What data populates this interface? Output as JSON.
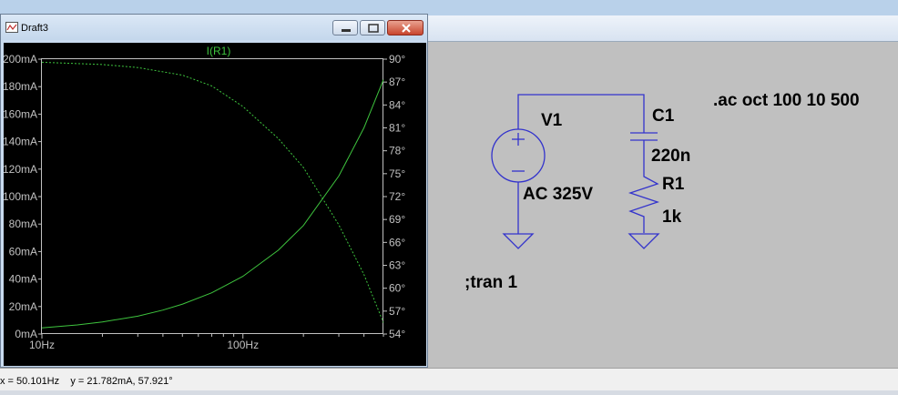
{
  "window": {
    "title": "Draft3",
    "trace_name": "I(R1)"
  },
  "chart_data": {
    "type": "line",
    "title": "I(R1)",
    "x_scale": "log",
    "xlim": [
      10,
      500
    ],
    "x_tick_labels": [
      "10Hz",
      "100Hz"
    ],
    "ylim_left": [
      0,
      200
    ],
    "y_left_ticks": [
      "200mA",
      "180mA",
      "160mA",
      "140mA",
      "120mA",
      "100mA",
      "80mA",
      "60mA",
      "40mA",
      "20mA",
      "0mA"
    ],
    "ylim_right": [
      54,
      90
    ],
    "y_right_ticks": [
      "90°",
      "87°",
      "84°",
      "81°",
      "78°",
      "75°",
      "72°",
      "69°",
      "66°",
      "63°",
      "60°",
      "57°",
      "54°"
    ],
    "grid": false,
    "series": [
      {
        "axis": "left",
        "style": "solid",
        "x": [
          10,
          15,
          20,
          30,
          40,
          50.101,
          70,
          100,
          150,
          200,
          300,
          400,
          500
        ],
        "y": [
          4.5,
          6.6,
          8.8,
          13.0,
          17.4,
          21.8,
          30.0,
          42.0,
          61.0,
          79.0,
          115.0,
          150.0,
          185.0
        ]
      },
      {
        "axis": "right",
        "style": "dashed",
        "x": [
          10,
          20,
          30,
          50.101,
          70,
          100,
          150,
          200,
          300,
          400,
          500
        ],
        "y": [
          89.6,
          89.3,
          88.9,
          87.9,
          86.5,
          83.8,
          79.6,
          75.8,
          68.3,
          61.8,
          55.5
        ]
      }
    ]
  },
  "schematic": {
    "directive_ac": ".ac oct 100 10 500",
    "directive_tran": ";tran 1",
    "source_name": "V1",
    "source_value": "AC 325V",
    "cap_name": "C1",
    "cap_value": "220n",
    "res_name": "R1",
    "res_value": "1k"
  },
  "status": {
    "text": "x = 50.101Hz    y = 21.782mA, 57.921°"
  },
  "colors": {
    "trace": "#3ec43e",
    "wire": "#3333cc",
    "plot_bg": "#000000",
    "schematic_bg": "#c0c0c0"
  }
}
